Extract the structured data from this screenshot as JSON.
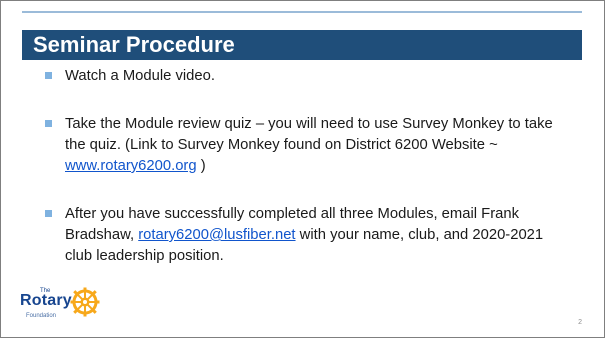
{
  "slide": {
    "title": "Seminar Procedure",
    "bullets": [
      {
        "text": "Watch a Module video."
      },
      {
        "text_before": "Take the Module review quiz – you will need to use Survey Monkey to take the quiz. (Link to Survey Monkey found on District 6200 Website ~ ",
        "link": "www.rotary6200.org",
        "text_after": " )"
      },
      {
        "text_before": "After you have successfully completed all three Modules, email Frank Bradshaw, ",
        "link": "rotary6200@lusfiber.net",
        "text_after": " with your name, club, and 2020-2021 club leadership position."
      }
    ],
    "page_number": "2"
  },
  "logo": {
    "the": "The",
    "word": "Rotary",
    "sub": "Foundation",
    "icon": "rotary-wheel-icon"
  },
  "colors": {
    "title_bar": "#1f4e7a",
    "top_rule": "#9bbbd9",
    "bullet": "#7fb2e0",
    "link": "#1155cc",
    "logo_blue": "#17458f",
    "wheel_gold": "#f7a81b"
  }
}
